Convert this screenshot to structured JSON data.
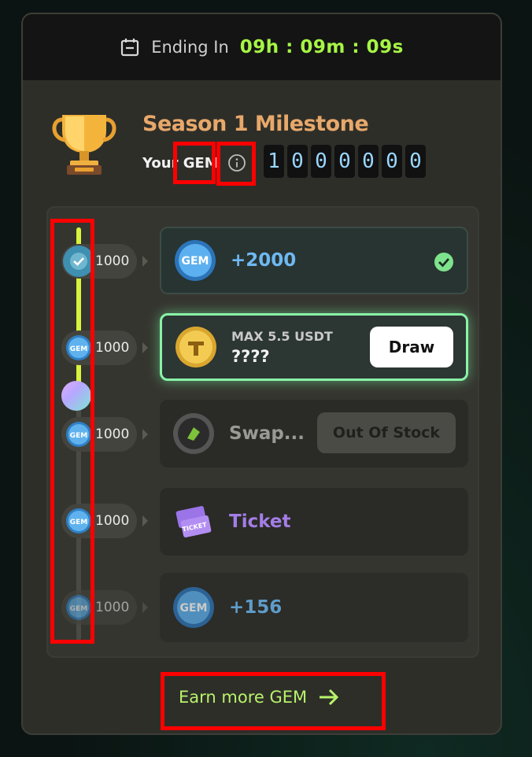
{
  "header": {
    "ending_label": "Ending In",
    "ending_time": "09h : 09m : 09s"
  },
  "milestone": {
    "title": "Season 1 Milestone",
    "your_gem_label": "Your GEM",
    "gem_digits": [
      "1",
      "0",
      "0",
      "0",
      "0",
      "0",
      "0"
    ]
  },
  "progress": {
    "fill_fraction": 0.4
  },
  "tiers": [
    {
      "threshold": "1000",
      "status": "claimed"
    },
    {
      "threshold": "1000",
      "status": "available"
    },
    {
      "threshold": "1000",
      "status": "out_of_stock"
    },
    {
      "threshold": "1000",
      "status": "locked"
    },
    {
      "threshold": "1000",
      "status": "locked"
    }
  ],
  "rewards": [
    {
      "text": "+2000",
      "icon": "gem-icon",
      "claimed_icon": "check-circle-icon"
    },
    {
      "max_label": "MAX 5.5 USDT",
      "text": "????",
      "icon": "usdt-coin-icon",
      "button": "Draw"
    },
    {
      "text": "Swap...",
      "icon": "swap-token-icon",
      "button": "Out Of Stock"
    },
    {
      "text": "Ticket",
      "icon": "ticket-icon"
    },
    {
      "text": "+156",
      "icon": "gem-icon"
    }
  ],
  "footer": {
    "earn_label": "Earn more GEM",
    "arrow_icon": "arrow-right-icon"
  },
  "colors": {
    "accent_green": "#a6f545",
    "season_gold": "#e7a86a",
    "reward_blue": "#6fb8f2",
    "ticket_purple": "#a37de6",
    "highlight_red": "#ff0000"
  }
}
